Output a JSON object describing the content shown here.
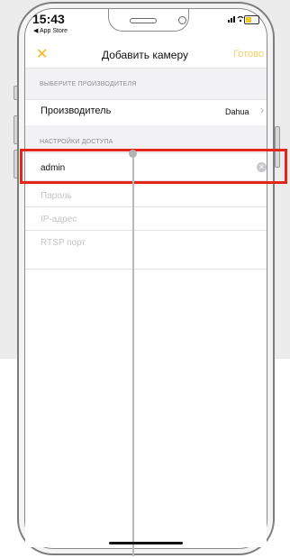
{
  "status_bar": {
    "time": "15:43",
    "back_app": "◀ App Store"
  },
  "nav": {
    "close_icon": "✕",
    "title": "Добавить камеру",
    "done": "Готово"
  },
  "section_vendor": {
    "label": "ВЫБЕРИТЕ ПРОИЗВОДИТЕЛЯ"
  },
  "vendor_row": {
    "label": "Производитель",
    "value": "Dahua"
  },
  "section_access": {
    "label": "НАСТРОЙКИ ДОСТУПА"
  },
  "login_field": {
    "value": "admin"
  },
  "password_field": {
    "placeholder": "Пароль"
  },
  "ip_field": {
    "placeholder": "IP-адрес"
  },
  "rtsp_field": {
    "placeholder": "RTSP порт"
  },
  "colors": {
    "accent": "#f5b915",
    "highlight": "#e3261b"
  }
}
